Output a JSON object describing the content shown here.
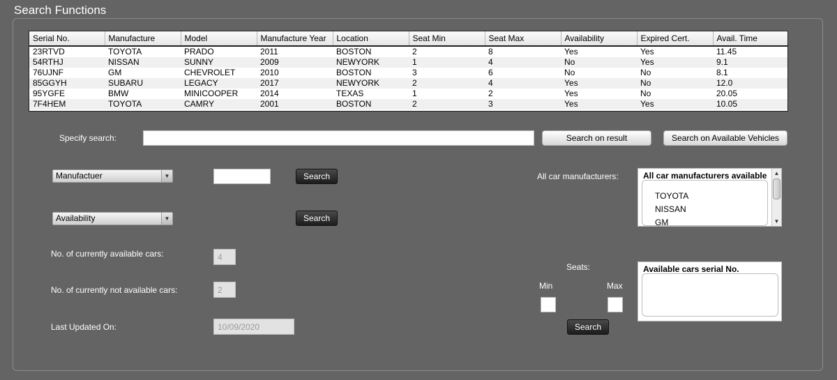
{
  "window": {
    "title": "Search Functions"
  },
  "table": {
    "columns": [
      "Serial No.",
      "Manufacture",
      "Model",
      "Manufacture Year",
      "Location",
      "Seat Min",
      "Seat Max",
      "Availability",
      "Expired Cert.",
      "Avail. Time"
    ],
    "rows": [
      [
        "23RTVD",
        "TOYOTA",
        "PRADO",
        "2011",
        "BOSTON",
        "2",
        "8",
        "Yes",
        "Yes",
        "11.45"
      ],
      [
        "54RTHJ",
        "NISSAN",
        "SUNNY",
        "2009",
        "NEWYORK",
        "1",
        "4",
        "No",
        "Yes",
        "9.1"
      ],
      [
        "76UJNF",
        "GM",
        "CHEVROLET",
        "2010",
        "BOSTON",
        "3",
        "6",
        "No",
        "No",
        "8.1"
      ],
      [
        "85GGYH",
        "SUBARU",
        "LEGACY",
        "2017",
        "NEWYORK",
        "2",
        "4",
        "Yes",
        "No",
        "12.0"
      ],
      [
        "95YGFE",
        "BMW",
        "MINICOOPER",
        "2014",
        "TEXAS",
        "1",
        "2",
        "Yes",
        "No",
        "20.05"
      ],
      [
        "7F4HEM",
        "TOYOTA",
        "CAMRY",
        "2001",
        "BOSTON",
        "2",
        "3",
        "Yes",
        "Yes",
        "10.05"
      ]
    ]
  },
  "search": {
    "label": "Specify search:",
    "value": "",
    "result_button": "Search on result",
    "available_button": "Search on Available Vehicles"
  },
  "filters": {
    "manufacturer_select": "Manufactuer",
    "manufacturer_value": "",
    "availability_select": "Availability",
    "search_button": "Search"
  },
  "stats": {
    "available_label": "No. of currently available cars:",
    "available_value": "4",
    "not_available_label": "No. of currently not available cars:",
    "not_available_value": "2",
    "updated_label": "Last Updated On:",
    "updated_value": "10/09/2020"
  },
  "manufacturers": {
    "label": "All car manufacturers:",
    "title": "All car manufacturers available",
    "items": [
      "TOYOTA",
      "NISSAN",
      "GM"
    ]
  },
  "seats": {
    "label": "Seats:",
    "min_label": "Min",
    "max_label": "Max",
    "min_value": "",
    "max_value": "",
    "search_button": "Search"
  },
  "serials": {
    "title": "Available cars serial No."
  },
  "icons": {
    "dropdown": "triangle-down-icon",
    "scroll_up": "triangle-up-icon",
    "scroll_down": "triangle-down-icon"
  }
}
